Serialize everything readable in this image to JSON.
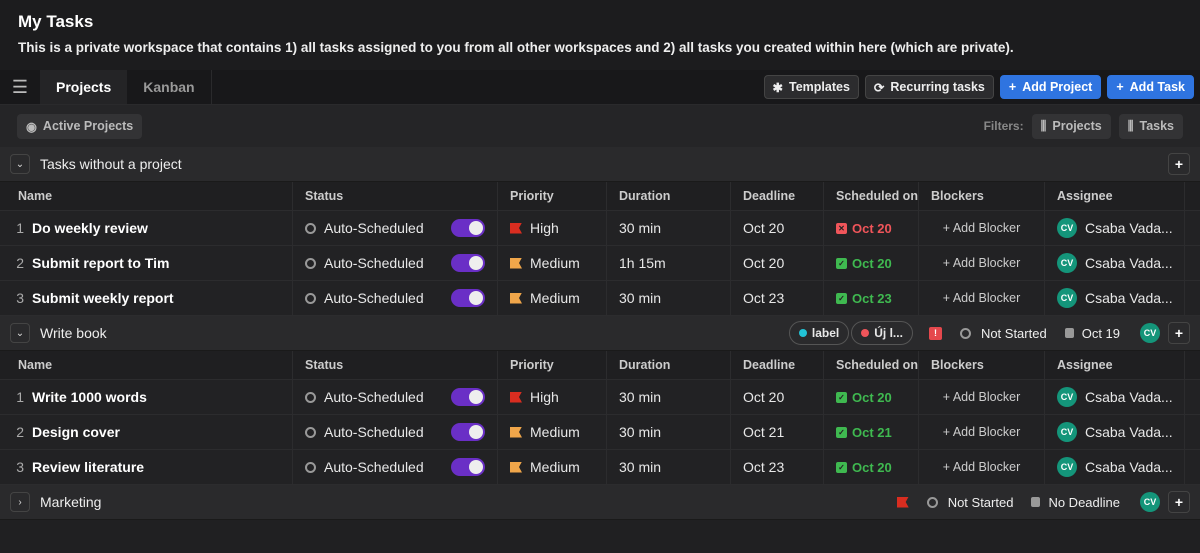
{
  "header": {
    "title": "My Tasks",
    "description": "This is a private workspace that contains 1) all tasks assigned to you from all other workspaces and 2) all tasks you created within here (which are private)."
  },
  "tabs": [
    {
      "label": "Projects",
      "active": true
    },
    {
      "label": "Kanban",
      "active": false
    }
  ],
  "toolbar": {
    "templates": "Templates",
    "recurring": "Recurring tasks",
    "add_project": "Add Project",
    "add_task": "Add Task"
  },
  "filters": {
    "active_projects": "Active Projects",
    "label": "Filters:",
    "projects": "Projects",
    "tasks": "Tasks"
  },
  "columns": [
    "Name",
    "Status",
    "Priority",
    "Duration",
    "Deadline",
    "Scheduled on",
    "Blockers",
    "Assignee"
  ],
  "colors": {
    "accent": "#2f74e0",
    "toggle": "#6a2fc6",
    "high": "#d92d20",
    "medium": "#f0a64a",
    "ok": "#3fb950",
    "late": "#f0555a",
    "avatar": "#14957a"
  },
  "groups": [
    {
      "name": "Tasks without a project",
      "expanded": true,
      "tasks": [
        {
          "num": "1",
          "name": "Do weekly review",
          "status": "Auto-Scheduled",
          "priority": "High",
          "duration": "30 min",
          "deadline": "Oct 20",
          "scheduled": "Oct 20",
          "scheduled_state": "late",
          "blocker": "+ Add Blocker",
          "assignee_initials": "CV",
          "assignee": "Csaba Vada..."
        },
        {
          "num": "2",
          "name": "Submit report to Tim",
          "status": "Auto-Scheduled",
          "priority": "Medium",
          "duration": "1h 15m",
          "deadline": "Oct 20",
          "scheduled": "Oct 20",
          "scheduled_state": "ok",
          "blocker": "+ Add Blocker",
          "assignee_initials": "CV",
          "assignee": "Csaba Vada..."
        },
        {
          "num": "3",
          "name": "Submit weekly report",
          "status": "Auto-Scheduled",
          "priority": "Medium",
          "duration": "30 min",
          "deadline": "Oct 23",
          "scheduled": "Oct 23",
          "scheduled_state": "ok",
          "blocker": "+ Add Blocker",
          "assignee_initials": "CV",
          "assignee": "Csaba Vada..."
        }
      ]
    },
    {
      "name": "Write book",
      "expanded": true,
      "labels": [
        {
          "text": "label",
          "color": "#22c3d6"
        },
        {
          "text": "Új l...",
          "color": "#f0555a"
        }
      ],
      "priority": "urgent",
      "status": "Not Started",
      "deadline": "Oct 19",
      "assignee_initials": "CV",
      "tasks": [
        {
          "num": "1",
          "name": "Write 1000 words",
          "status": "Auto-Scheduled",
          "priority": "High",
          "duration": "30 min",
          "deadline": "Oct 20",
          "scheduled": "Oct 20",
          "scheduled_state": "ok",
          "blocker": "+ Add Blocker",
          "assignee_initials": "CV",
          "assignee": "Csaba Vada..."
        },
        {
          "num": "2",
          "name": "Design cover",
          "status": "Auto-Scheduled",
          "priority": "Medium",
          "duration": "30 min",
          "deadline": "Oct 21",
          "scheduled": "Oct 21",
          "scheduled_state": "ok",
          "blocker": "+ Add Blocker",
          "assignee_initials": "CV",
          "assignee": "Csaba Vada..."
        },
        {
          "num": "3",
          "name": "Review literature",
          "status": "Auto-Scheduled",
          "priority": "Medium",
          "duration": "30 min",
          "deadline": "Oct 23",
          "scheduled": "Oct 20",
          "scheduled_state": "ok",
          "blocker": "+ Add Blocker",
          "assignee_initials": "CV",
          "assignee": "Csaba Vada..."
        }
      ]
    },
    {
      "name": "Marketing",
      "expanded": false,
      "priority": "High",
      "status": "Not Started",
      "deadline": "No Deadline",
      "assignee_initials": "CV",
      "tasks": []
    }
  ]
}
